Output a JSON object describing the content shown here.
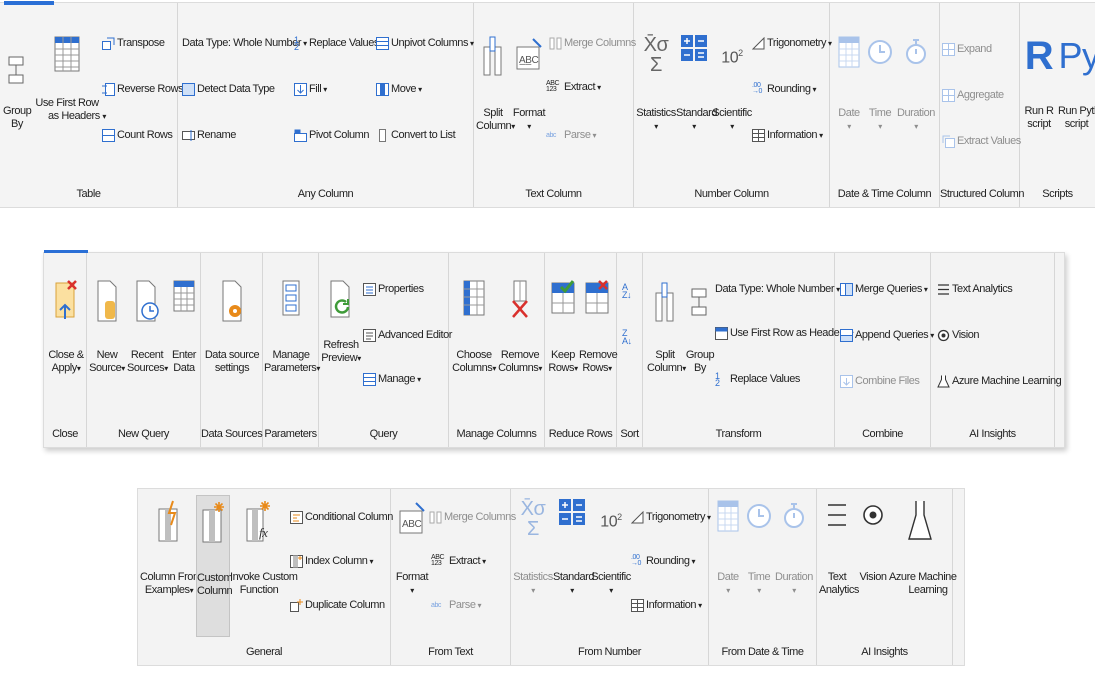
{
  "ribbon1": {
    "groups": {
      "table": "Table",
      "any": "Any Column",
      "text": "Text Column",
      "number": "Number Column",
      "date": "Date & Time Column",
      "structured": "Structured Column",
      "scripts": "Scripts"
    },
    "group_by": [
      "Group",
      "By"
    ],
    "use_first_row": [
      "Use First Row",
      "as Headers"
    ],
    "transpose": "Transpose",
    "reverse_rows": "Reverse Rows",
    "count_rows": "Count Rows",
    "data_type": "Data Type: Whole Number",
    "detect_data_type": "Detect Data Type",
    "rename": "Rename",
    "replace_values": "Replace Values",
    "fill": "Fill",
    "pivot_column": "Pivot Column",
    "unpivot_columns": "Unpivot Columns",
    "move": "Move",
    "convert_to_list": "Convert to List",
    "split_column": [
      "Split",
      "Column"
    ],
    "format": "Format",
    "merge_columns": "Merge Columns",
    "extract": "Extract",
    "parse": "Parse",
    "statistics": "Statistics",
    "standard": "Standard",
    "scientific": "Scientific",
    "trigonometry": "Trigonometry",
    "rounding": "Rounding",
    "information": "Information",
    "date": "Date",
    "time": "Time",
    "duration": "Duration",
    "expand": "Expand",
    "aggregate": "Aggregate",
    "extract_values": "Extract Values",
    "run_r": [
      "Run R",
      "script"
    ],
    "run_python": [
      "Run Python",
      "script"
    ]
  },
  "ribbon2": {
    "groups": {
      "close": "Close",
      "new_query": "New Query",
      "data_sources": "Data Sources",
      "parameters": "Parameters",
      "query": "Query",
      "manage_columns": "Manage Columns",
      "reduce_rows": "Reduce Rows",
      "sort": "Sort",
      "transform": "Transform",
      "combine": "Combine",
      "ai": "AI Insights"
    },
    "close_apply": [
      "Close &",
      "Apply"
    ],
    "new_source": [
      "New",
      "Source"
    ],
    "recent_sources": [
      "Recent",
      "Sources"
    ],
    "enter_data": [
      "Enter",
      "Data"
    ],
    "data_source_settings": [
      "Data source",
      "settings"
    ],
    "manage_parameters": [
      "Manage",
      "Parameters"
    ],
    "refresh_preview": [
      "Refresh",
      "Preview"
    ],
    "properties": "Properties",
    "advanced_editor": "Advanced Editor",
    "manage": "Manage",
    "choose_columns": [
      "Choose",
      "Columns"
    ],
    "remove_columns": [
      "Remove",
      "Columns"
    ],
    "keep_rows": [
      "Keep",
      "Rows"
    ],
    "remove_rows": [
      "Remove",
      "Rows"
    ],
    "split_column": [
      "Split",
      "Column"
    ],
    "group_by": [
      "Group",
      "By"
    ],
    "data_type": "Data Type: Whole Number",
    "use_first_row": "Use First Row as Headers",
    "replace_values": "Replace Values",
    "merge_queries": "Merge Queries",
    "append_queries": "Append Queries",
    "combine_files": "Combine Files",
    "text_analytics": "Text Analytics",
    "vision": "Vision",
    "azure_ml": "Azure Machine Learning"
  },
  "ribbon3": {
    "groups": {
      "general": "General",
      "from_text": "From Text",
      "from_number": "From Number",
      "from_date": "From Date & Time",
      "ai": "AI Insights"
    },
    "column_from_examples": [
      "Column From",
      "Examples"
    ],
    "custom_column": [
      "Custom",
      "Column"
    ],
    "invoke_custom_function": [
      "Invoke Custom",
      "Function"
    ],
    "conditional_column": "Conditional Column",
    "index_column": "Index Column",
    "duplicate_column": "Duplicate Column",
    "format": "Format",
    "merge_columns": "Merge Columns",
    "extract": "Extract",
    "parse": "Parse",
    "statistics": "Statistics",
    "standard": "Standard",
    "scientific": "Scientific",
    "trigonometry": "Trigonometry",
    "rounding": "Rounding",
    "information": "Information",
    "date": "Date",
    "time": "Time",
    "duration": "Duration",
    "text_analytics": [
      "Text",
      "Analytics"
    ],
    "vision": "Vision",
    "azure_ml": [
      "Azure Machine",
      "Learning"
    ]
  },
  "colors": {
    "blue": "#2f6fcf",
    "accent": "#2a6fd6",
    "orange": "#e88a1a",
    "red": "#d9302c",
    "green": "#3f9b39"
  }
}
